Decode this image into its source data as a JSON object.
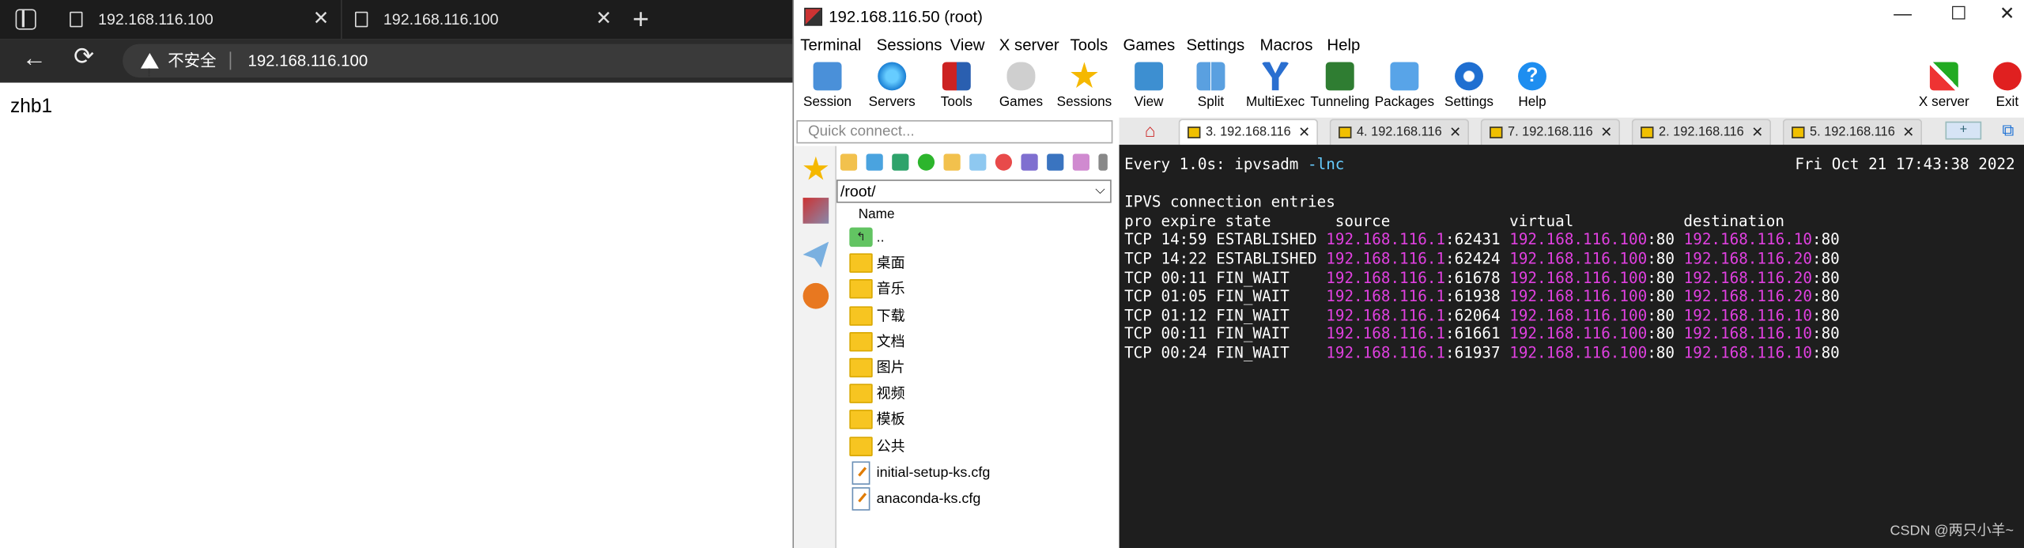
{
  "browser": {
    "tabs": [
      {
        "title": "192.168.116.100"
      },
      {
        "title": "192.168.116.100"
      }
    ],
    "newtab": "+",
    "insecure_label": "不安全",
    "url": "192.168.116.100",
    "page_text": "zhb1"
  },
  "moba": {
    "title": "192.168.116.50 (root)",
    "menu": [
      "Terminal",
      "Sessions",
      "View",
      "X server",
      "Tools",
      "Games",
      "Settings",
      "Macros",
      "Help"
    ],
    "toolbar": [
      "Session",
      "Servers",
      "Tools",
      "Games",
      "Sessions",
      "View",
      "Split",
      "MultiExec",
      "Tunneling",
      "Packages",
      "Settings",
      "Help"
    ],
    "toolbar_right": [
      "X server",
      "Exit"
    ],
    "quick_connect_placeholder": "Quick connect...",
    "path": "/root/",
    "file_header": "Name",
    "files": [
      {
        "name": "..",
        "type": "up"
      },
      {
        "name": "桌面",
        "type": "folder"
      },
      {
        "name": "音乐",
        "type": "folder"
      },
      {
        "name": "下载",
        "type": "folder"
      },
      {
        "name": "文档",
        "type": "folder"
      },
      {
        "name": "图片",
        "type": "folder"
      },
      {
        "name": "视频",
        "type": "folder"
      },
      {
        "name": "模板",
        "type": "folder"
      },
      {
        "name": "公共",
        "type": "folder"
      },
      {
        "name": "initial-setup-ks.cfg",
        "type": "file"
      },
      {
        "name": "anaconda-ks.cfg",
        "type": "file"
      }
    ],
    "session_tabs": [
      {
        "label": "3. 192.168.116",
        "active": true
      },
      {
        "label": "4. 192.168.116",
        "active": false
      },
      {
        "label": "7. 192.168.116",
        "active": false
      },
      {
        "label": "2. 192.168.116",
        "active": false
      },
      {
        "label": "5. 192.168.116",
        "active": false
      }
    ],
    "terminal": {
      "watch_prefix": "Every 1.0s: ipvsadm ",
      "watch_flag": "-lnc",
      "timestamp": "Fri Oct 21 17:43:38 2022",
      "heading": "IPVS connection entries",
      "columns": "pro expire state       source             virtual            destination",
      "entries": [
        {
          "pro": "TCP",
          "expire": "14:59",
          "state": "ESTABLISHED",
          "src_ip": "192.168.116.1",
          "src_port": "62431",
          "vip": "192.168.116.100",
          "vport": "80",
          "dst_ip": "192.168.116.10",
          "dport": "80"
        },
        {
          "pro": "TCP",
          "expire": "14:22",
          "state": "ESTABLISHED",
          "src_ip": "192.168.116.1",
          "src_port": "62424",
          "vip": "192.168.116.100",
          "vport": "80",
          "dst_ip": "192.168.116.20",
          "dport": "80"
        },
        {
          "pro": "TCP",
          "expire": "00:11",
          "state": "FIN_WAIT",
          "src_ip": "192.168.116.1",
          "src_port": "61678",
          "vip": "192.168.116.100",
          "vport": "80",
          "dst_ip": "192.168.116.20",
          "dport": "80"
        },
        {
          "pro": "TCP",
          "expire": "01:05",
          "state": "FIN_WAIT",
          "src_ip": "192.168.116.1",
          "src_port": "61938",
          "vip": "192.168.116.100",
          "vport": "80",
          "dst_ip": "192.168.116.20",
          "dport": "80"
        },
        {
          "pro": "TCP",
          "expire": "01:12",
          "state": "FIN_WAIT",
          "src_ip": "192.168.116.1",
          "src_port": "62064",
          "vip": "192.168.116.100",
          "vport": "80",
          "dst_ip": "192.168.116.10",
          "dport": "80"
        },
        {
          "pro": "TCP",
          "expire": "00:11",
          "state": "FIN_WAIT",
          "src_ip": "192.168.116.1",
          "src_port": "61661",
          "vip": "192.168.116.100",
          "vport": "80",
          "dst_ip": "192.168.116.10",
          "dport": "80"
        },
        {
          "pro": "TCP",
          "expire": "00:24",
          "state": "FIN_WAIT",
          "src_ip": "192.168.116.1",
          "src_port": "61937",
          "vip": "192.168.116.100",
          "vport": "80",
          "dst_ip": "192.168.116.10",
          "dport": "80"
        }
      ],
      "ip_color": "#e040e0"
    },
    "watermark": "CSDN @两只小羊~"
  }
}
